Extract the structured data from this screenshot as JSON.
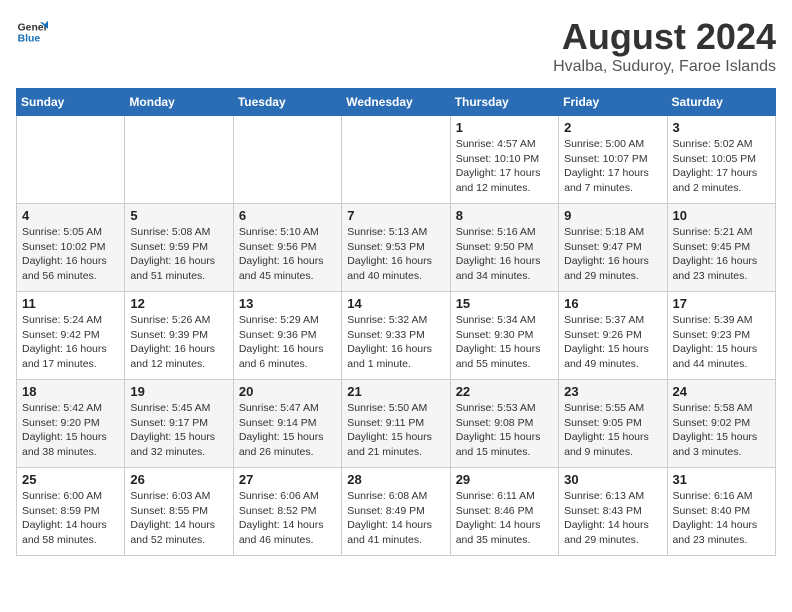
{
  "logo": {
    "line1": "General",
    "line2": "Blue"
  },
  "title": "August 2024",
  "subtitle": "Hvalba, Suduroy, Faroe Islands",
  "weekdays": [
    "Sunday",
    "Monday",
    "Tuesday",
    "Wednesday",
    "Thursday",
    "Friday",
    "Saturday"
  ],
  "weeks": [
    [
      {
        "day": "",
        "info": ""
      },
      {
        "day": "",
        "info": ""
      },
      {
        "day": "",
        "info": ""
      },
      {
        "day": "",
        "info": ""
      },
      {
        "day": "1",
        "info": "Sunrise: 4:57 AM\nSunset: 10:10 PM\nDaylight: 17 hours\nand 12 minutes."
      },
      {
        "day": "2",
        "info": "Sunrise: 5:00 AM\nSunset: 10:07 PM\nDaylight: 17 hours\nand 7 minutes."
      },
      {
        "day": "3",
        "info": "Sunrise: 5:02 AM\nSunset: 10:05 PM\nDaylight: 17 hours\nand 2 minutes."
      }
    ],
    [
      {
        "day": "4",
        "info": "Sunrise: 5:05 AM\nSunset: 10:02 PM\nDaylight: 16 hours\nand 56 minutes."
      },
      {
        "day": "5",
        "info": "Sunrise: 5:08 AM\nSunset: 9:59 PM\nDaylight: 16 hours\nand 51 minutes."
      },
      {
        "day": "6",
        "info": "Sunrise: 5:10 AM\nSunset: 9:56 PM\nDaylight: 16 hours\nand 45 minutes."
      },
      {
        "day": "7",
        "info": "Sunrise: 5:13 AM\nSunset: 9:53 PM\nDaylight: 16 hours\nand 40 minutes."
      },
      {
        "day": "8",
        "info": "Sunrise: 5:16 AM\nSunset: 9:50 PM\nDaylight: 16 hours\nand 34 minutes."
      },
      {
        "day": "9",
        "info": "Sunrise: 5:18 AM\nSunset: 9:47 PM\nDaylight: 16 hours\nand 29 minutes."
      },
      {
        "day": "10",
        "info": "Sunrise: 5:21 AM\nSunset: 9:45 PM\nDaylight: 16 hours\nand 23 minutes."
      }
    ],
    [
      {
        "day": "11",
        "info": "Sunrise: 5:24 AM\nSunset: 9:42 PM\nDaylight: 16 hours\nand 17 minutes."
      },
      {
        "day": "12",
        "info": "Sunrise: 5:26 AM\nSunset: 9:39 PM\nDaylight: 16 hours\nand 12 minutes."
      },
      {
        "day": "13",
        "info": "Sunrise: 5:29 AM\nSunset: 9:36 PM\nDaylight: 16 hours\nand 6 minutes."
      },
      {
        "day": "14",
        "info": "Sunrise: 5:32 AM\nSunset: 9:33 PM\nDaylight: 16 hours\nand 1 minute."
      },
      {
        "day": "15",
        "info": "Sunrise: 5:34 AM\nSunset: 9:30 PM\nDaylight: 15 hours\nand 55 minutes."
      },
      {
        "day": "16",
        "info": "Sunrise: 5:37 AM\nSunset: 9:26 PM\nDaylight: 15 hours\nand 49 minutes."
      },
      {
        "day": "17",
        "info": "Sunrise: 5:39 AM\nSunset: 9:23 PM\nDaylight: 15 hours\nand 44 minutes."
      }
    ],
    [
      {
        "day": "18",
        "info": "Sunrise: 5:42 AM\nSunset: 9:20 PM\nDaylight: 15 hours\nand 38 minutes."
      },
      {
        "day": "19",
        "info": "Sunrise: 5:45 AM\nSunset: 9:17 PM\nDaylight: 15 hours\nand 32 minutes."
      },
      {
        "day": "20",
        "info": "Sunrise: 5:47 AM\nSunset: 9:14 PM\nDaylight: 15 hours\nand 26 minutes."
      },
      {
        "day": "21",
        "info": "Sunrise: 5:50 AM\nSunset: 9:11 PM\nDaylight: 15 hours\nand 21 minutes."
      },
      {
        "day": "22",
        "info": "Sunrise: 5:53 AM\nSunset: 9:08 PM\nDaylight: 15 hours\nand 15 minutes."
      },
      {
        "day": "23",
        "info": "Sunrise: 5:55 AM\nSunset: 9:05 PM\nDaylight: 15 hours\nand 9 minutes."
      },
      {
        "day": "24",
        "info": "Sunrise: 5:58 AM\nSunset: 9:02 PM\nDaylight: 15 hours\nand 3 minutes."
      }
    ],
    [
      {
        "day": "25",
        "info": "Sunrise: 6:00 AM\nSunset: 8:59 PM\nDaylight: 14 hours\nand 58 minutes."
      },
      {
        "day": "26",
        "info": "Sunrise: 6:03 AM\nSunset: 8:55 PM\nDaylight: 14 hours\nand 52 minutes."
      },
      {
        "day": "27",
        "info": "Sunrise: 6:06 AM\nSunset: 8:52 PM\nDaylight: 14 hours\nand 46 minutes."
      },
      {
        "day": "28",
        "info": "Sunrise: 6:08 AM\nSunset: 8:49 PM\nDaylight: 14 hours\nand 41 minutes."
      },
      {
        "day": "29",
        "info": "Sunrise: 6:11 AM\nSunset: 8:46 PM\nDaylight: 14 hours\nand 35 minutes."
      },
      {
        "day": "30",
        "info": "Sunrise: 6:13 AM\nSunset: 8:43 PM\nDaylight: 14 hours\nand 29 minutes."
      },
      {
        "day": "31",
        "info": "Sunrise: 6:16 AM\nSunset: 8:40 PM\nDaylight: 14 hours\nand 23 minutes."
      }
    ]
  ]
}
